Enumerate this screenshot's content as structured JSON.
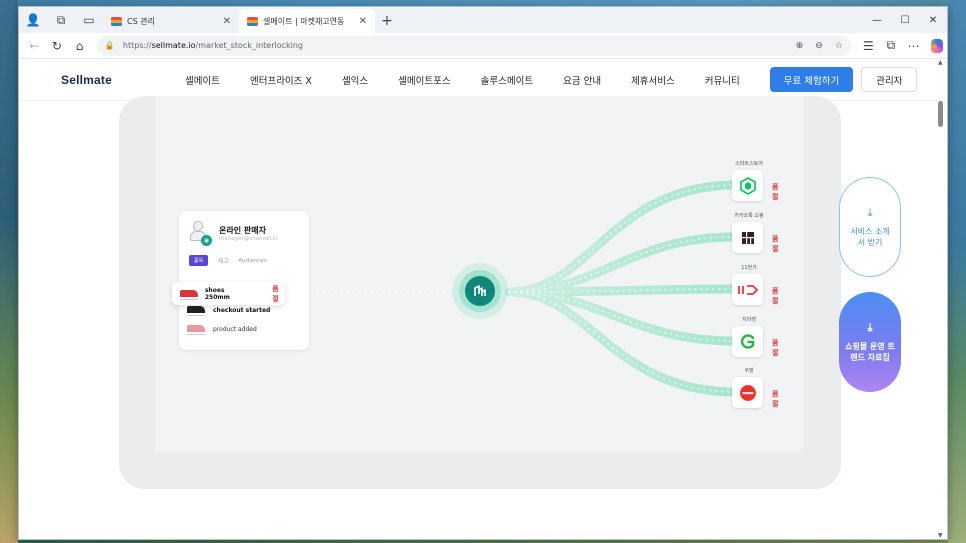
{
  "browser": {
    "tabs": [
      {
        "title": "CS 관리",
        "active": false
      },
      {
        "title": "셀메이트 | 마켓재고연동",
        "active": true
      }
    ],
    "address": {
      "scheme": "https://",
      "host": "sellmate.io",
      "path": "/market_stock_interlocking"
    }
  },
  "site": {
    "logo": "Sellmate",
    "nav": [
      "셀메이트",
      "엔터프라이즈 X",
      "셀익스",
      "셀메이트포스",
      "솔루스메이트",
      "요금 안내",
      "제휴서비스",
      "커뮤니티"
    ],
    "cta_label": "무료 체험하기",
    "admin_label": "관리자"
  },
  "illustration": {
    "seller": {
      "name": "온라인 판매자",
      "email": "manager@channel.kr",
      "tabs": [
        "품목",
        "재고",
        "Audiences"
      ],
      "events": [
        {
          "label": "shoes 250mm",
          "status": "품절",
          "shoe_color": "#d8343a"
        },
        {
          "label": "checkout started",
          "shoe_color": "#222222"
        },
        {
          "label": "product added",
          "shoe_color": "#e59aa0"
        }
      ]
    },
    "hub_icon": "sellmate-hub-icon",
    "markets": [
      {
        "name": "스마트스토어",
        "status": "품절",
        "icon": "smartstore-icon",
        "color": "#03c75a"
      },
      {
        "name": "카카오톡 쇼핑",
        "status": "품절",
        "icon": "kakao-shopping-icon",
        "color": "#3c1e1e"
      },
      {
        "name": "11번가",
        "status": "품절",
        "icon": "11st-icon",
        "color": "#f43142"
      },
      {
        "name": "지마켓",
        "status": "품절",
        "icon": "gmarket-icon",
        "color": "#28b446"
      },
      {
        "name": "쿠팡",
        "status": "품절",
        "icon": "coupang-icon",
        "color": "#e8322b"
      }
    ]
  },
  "side_buttons": {
    "intro": "서비스 소개서 받기",
    "trend": "쇼핑몰 운영 트렌드 자료집"
  },
  "colors": {
    "accent": "#2f7de8",
    "teal": "#13867a",
    "soldout": "#e33c3c"
  }
}
